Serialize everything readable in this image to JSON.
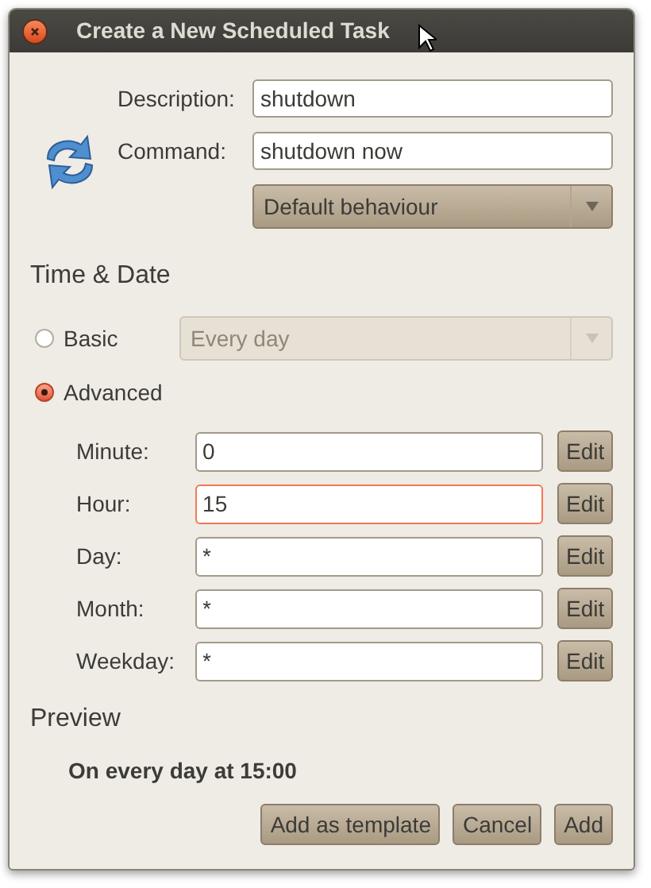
{
  "window": {
    "title": "Create a New Scheduled Task"
  },
  "task": {
    "fields": [
      {
        "label": "Description:",
        "value": "shutdown"
      },
      {
        "label": "Command:",
        "value": "shutdown now"
      }
    ],
    "behaviour": {
      "value": "Default behaviour"
    }
  },
  "time_date": {
    "heading": "Time & Date",
    "modes": [
      {
        "label": "Basic",
        "selected": false
      },
      {
        "label": "Advanced",
        "selected": true
      }
    ],
    "basic_dropdown": {
      "value": "Every day",
      "disabled": true
    },
    "fields": [
      {
        "label": "Minute:",
        "value": "0",
        "focused": false,
        "button": "Edit"
      },
      {
        "label": "Hour:",
        "value": "15",
        "focused": true,
        "button": "Edit"
      },
      {
        "label": "Day:",
        "value": "*",
        "focused": false,
        "button": "Edit"
      },
      {
        "label": "Month:",
        "value": "*",
        "focused": false,
        "button": "Edit"
      },
      {
        "label": "Weekday:",
        "value": "*",
        "focused": false,
        "button": "Edit"
      }
    ]
  },
  "preview": {
    "heading": "Preview",
    "text": "On every day at 15:00"
  },
  "buttons": [
    "Add as template",
    "Cancel",
    "Add"
  ]
}
